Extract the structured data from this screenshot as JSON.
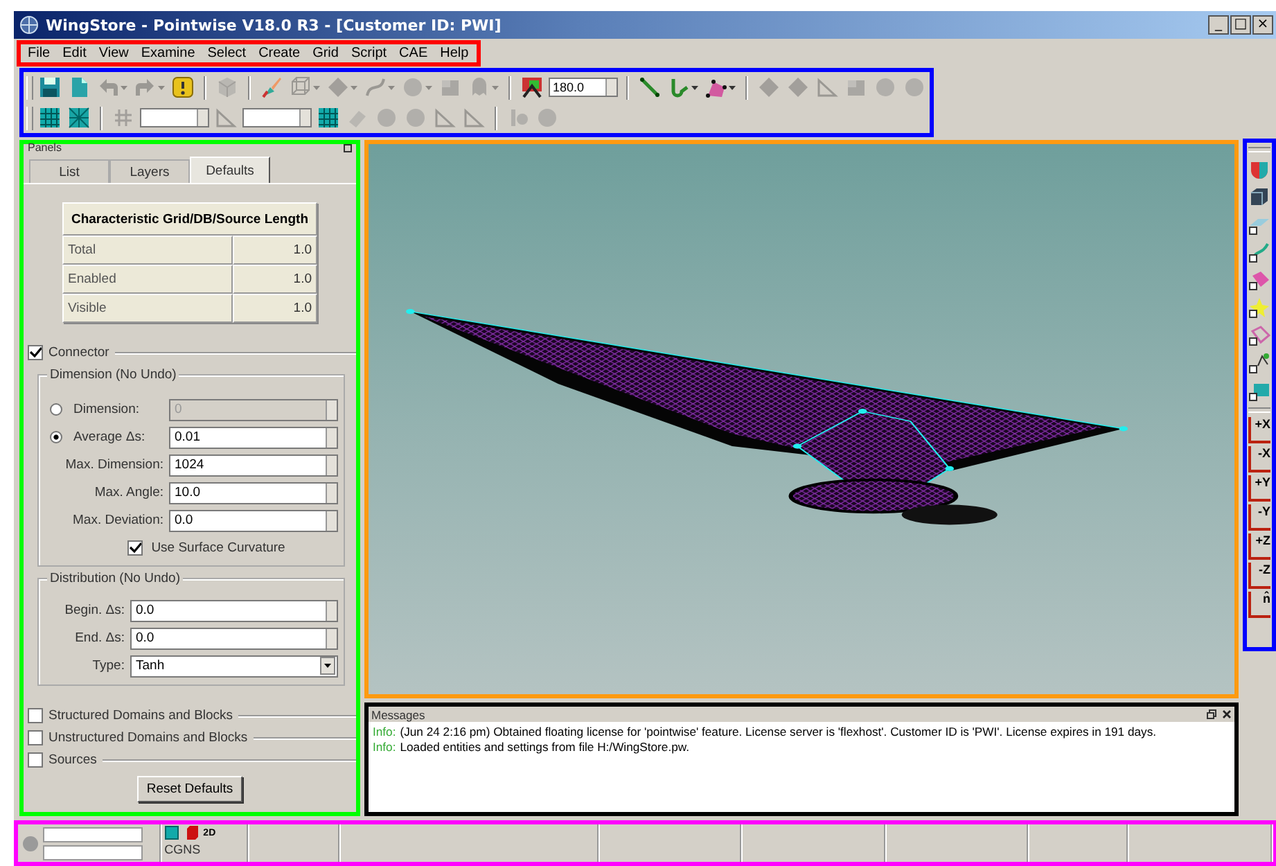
{
  "window": {
    "title": "WingStore - Pointwise V18.0 R3 - [Customer ID: PWI]",
    "controls": [
      "_",
      "□",
      "×"
    ]
  },
  "menu": [
    "File",
    "Edit",
    "View",
    "Examine",
    "Select",
    "Create",
    "Grid",
    "Script",
    "CAE",
    "Help"
  ],
  "toolbar_rows": [
    [
      {
        "kind": "button",
        "disabled": false,
        "dropdown": false
      },
      {
        "kind": "button",
        "disabled": false,
        "dropdown": false
      },
      {
        "kind": "button",
        "disabled": true,
        "dropdown": true
      },
      {
        "kind": "button",
        "disabled": true,
        "dropdown": true
      },
      {
        "kind": "button",
        "disabled": false,
        "dropdown": false
      },
      {
        "kind": "separator"
      },
      {
        "kind": "button",
        "disabled": true,
        "dropdown": false
      },
      {
        "kind": "separator"
      },
      {
        "kind": "button",
        "disabled": false,
        "dropdown": false
      },
      {
        "kind": "button",
        "disabled": true,
        "dropdown": true
      },
      {
        "kind": "button",
        "disabled": true,
        "dropdown": true
      },
      {
        "kind": "button",
        "disabled": true,
        "dropdown": true
      },
      {
        "kind": "button",
        "disabled": true,
        "dropdown": true
      },
      {
        "kind": "button",
        "disabled": true,
        "dropdown": false
      },
      {
        "kind": "button",
        "disabled": true,
        "dropdown": true
      },
      {
        "kind": "separator"
      },
      {
        "kind": "button",
        "disabled": false,
        "dropdown": false
      },
      {
        "kind": "field",
        "value": "180.0"
      },
      {
        "kind": "separator"
      },
      {
        "kind": "button",
        "disabled": false,
        "dropdown": false
      },
      {
        "kind": "button",
        "disabled": false,
        "dropdown": true
      },
      {
        "kind": "button",
        "disabled": false,
        "dropdown": true
      },
      {
        "kind": "separator"
      },
      {
        "kind": "button",
        "disabled": true,
        "dropdown": false
      },
      {
        "kind": "button",
        "disabled": true,
        "dropdown": false
      },
      {
        "kind": "button",
        "disabled": true,
        "dropdown": false
      },
      {
        "kind": "button",
        "disabled": true,
        "dropdown": false
      },
      {
        "kind": "button",
        "disabled": true,
        "dropdown": false
      },
      {
        "kind": "button",
        "disabled": true,
        "dropdown": false
      }
    ],
    [
      {
        "kind": "button",
        "disabled": false,
        "dropdown": false
      },
      {
        "kind": "button",
        "disabled": false,
        "dropdown": false
      },
      {
        "kind": "separator"
      },
      {
        "kind": "button",
        "disabled": true,
        "dropdown": false
      },
      {
        "kind": "field"
      },
      {
        "kind": "button",
        "disabled": true,
        "dropdown": false
      },
      {
        "kind": "field"
      },
      {
        "kind": "button",
        "disabled": false,
        "dropdown": false
      },
      {
        "kind": "button",
        "disabled": true,
        "dropdown": false
      },
      {
        "kind": "button",
        "disabled": true,
        "dropdown": false
      },
      {
        "kind": "button",
        "disabled": true,
        "dropdown": false
      },
      {
        "kind": "button",
        "disabled": true,
        "dropdown": false
      },
      {
        "kind": "button",
        "disabled": true,
        "dropdown": false
      },
      {
        "kind": "separator"
      },
      {
        "kind": "button",
        "disabled": true,
        "dropdown": false
      },
      {
        "kind": "button",
        "disabled": true,
        "dropdown": false
      }
    ]
  ],
  "panel": {
    "title": "Panels",
    "tabs": [
      {
        "label": "List",
        "selected": false
      },
      {
        "label": "Layers",
        "selected": false
      },
      {
        "label": "Defaults",
        "selected": true
      }
    ],
    "table": {
      "heading": "Characteristic Grid/DB/Source Length",
      "rows": [
        {
          "label": "Total",
          "value": "1.0"
        },
        {
          "label": "Enabled",
          "value": "1.0"
        },
        {
          "label": "Visible",
          "value": "1.0"
        }
      ]
    },
    "connector": {
      "label": "Connector",
      "checked": true,
      "dimension_group": {
        "title": "Dimension (No Undo)",
        "fields": [
          {
            "kind": "radio",
            "label": "Dimension:",
            "selected": false,
            "value": "0",
            "disabled": true
          },
          {
            "kind": "radio",
            "label": "Average Δs:",
            "selected": true,
            "value": "0.01",
            "disabled": false
          },
          {
            "kind": "spin",
            "label": "Max. Dimension:",
            "value": "1024",
            "disabled": false
          },
          {
            "kind": "spin",
            "label": "Max. Angle:",
            "value": "10.0",
            "disabled": false
          },
          {
            "kind": "spin",
            "label": "Max. Deviation:",
            "value": "0.0",
            "disabled": false
          }
        ],
        "curvature": {
          "label": "Use Surface Curvature",
          "checked": true
        }
      },
      "distribution_group": {
        "title": "Distribution (No Undo)",
        "fields": [
          {
            "kind": "spin",
            "label": "Begin. Δs:",
            "value": "0.0"
          },
          {
            "kind": "spin",
            "label": "End. Δs:",
            "value": "0.0"
          },
          {
            "kind": "select",
            "label": "Type:",
            "value": "Tanh"
          }
        ]
      }
    },
    "sections": [
      {
        "label": "Structured Domains and Blocks",
        "checked": false
      },
      {
        "label": "Unstructured Domains and Blocks",
        "checked": false
      },
      {
        "label": "Sources",
        "checked": false
      }
    ],
    "reset_button": "Reset Defaults"
  },
  "side_toolbar": {
    "tools": [
      {
        "disabled": false
      },
      {
        "disabled": false
      },
      {
        "disabled": false
      },
      {
        "disabled": false
      },
      {
        "disabled": false
      },
      {
        "disabled": false
      },
      {
        "disabled": false
      },
      {
        "disabled": false
      },
      {
        "disabled": false
      }
    ],
    "views": [
      "+X",
      "-X",
      "+Y",
      "-Y",
      "+Z",
      "-Z",
      "n̂"
    ]
  },
  "messages": {
    "title": "Messages",
    "lines": [
      {
        "prefix": "Info:",
        "text": "(Jun 24 2:16 pm) Obtained floating license for 'pointwise' feature. License server is 'flexhost'. Customer ID is 'PWI'. License expires in 191 days."
      },
      {
        "prefix": "Info:",
        "text": "Loaded entities and settings from file H:/WingStore.pw."
      }
    ]
  },
  "status_bar": {
    "mode": "2D",
    "solver": "CGNS"
  }
}
